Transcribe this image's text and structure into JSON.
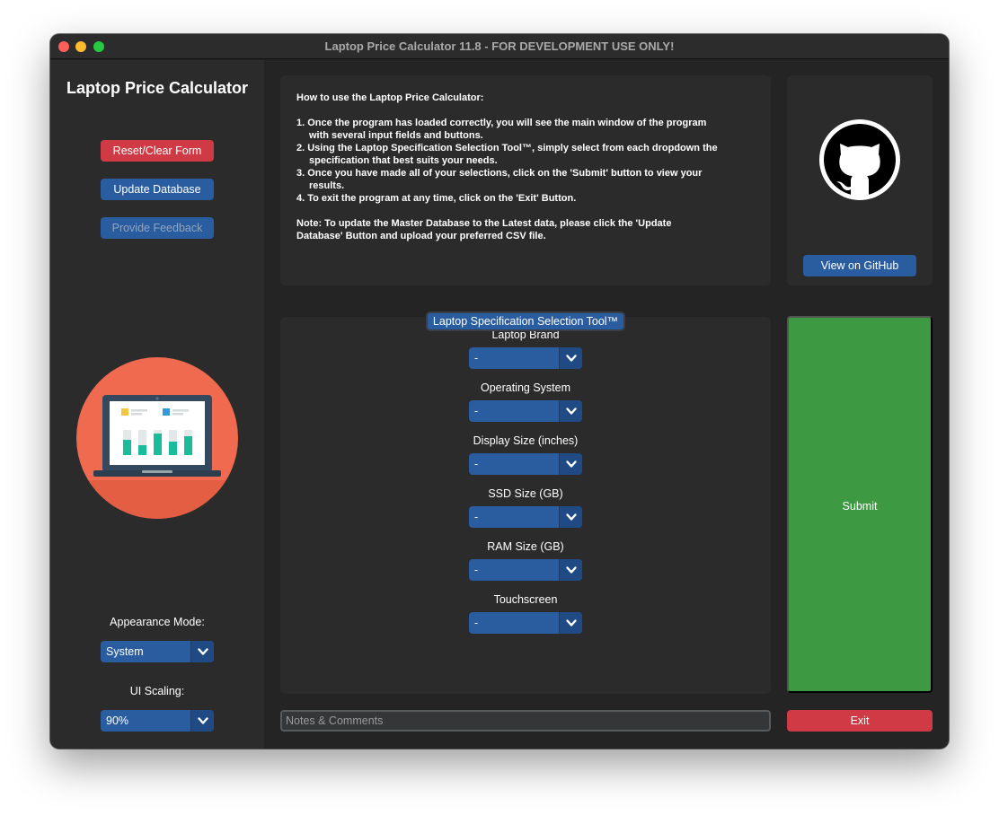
{
  "window": {
    "title": "Laptop Price Calculator 11.8 - FOR DEVELOPMENT USE ONLY!"
  },
  "sidebar": {
    "title": "Laptop Price Calculator",
    "reset_label": "Reset/Clear Form",
    "update_label": "Update Database",
    "feedback_label": "Provide Feedback",
    "appearance_label": "Appearance Mode:",
    "appearance_value": "System",
    "scaling_label": "UI Scaling:",
    "scaling_value": "90%"
  },
  "instructions": {
    "heading": "How to use the Laptop Price Calculator:",
    "steps": [
      "1. Once the program has loaded correctly, you will see the main window of the program with several input fields and buttons.",
      "2. Using the Laptop Specification Selection Tool™, simply select from each dropdown the specification that best suits your needs.",
      "3. Once you have made all of your selections, click on the 'Submit' button to view your results.",
      "4. To exit the program at any time, click on the 'Exit' Button."
    ],
    "note": "Note: To update the Master Database to the Latest data, please click the 'Update Database' Button and upload your preferred CSV file."
  },
  "github": {
    "button_label": "View on GitHub"
  },
  "spec_tool": {
    "title": "Laptop Specification Selection Tool™",
    "fields": [
      {
        "label": "Laptop Brand",
        "value": "-"
      },
      {
        "label": "Operating System",
        "value": "-"
      },
      {
        "label": "Display Size (inches)",
        "value": "-"
      },
      {
        "label": "SSD Size (GB)",
        "value": "-"
      },
      {
        "label": "RAM Size (GB)",
        "value": "-"
      },
      {
        "label": "Touchscreen",
        "value": "-"
      }
    ]
  },
  "actions": {
    "submit_label": "Submit",
    "exit_label": "Exit",
    "notes_placeholder": "Notes & Comments"
  },
  "colors": {
    "accent_blue": "#2a5d9f",
    "danger_red": "#cf3a45",
    "submit_green": "#3d9a42",
    "illustration_orange": "#ef6a4f"
  }
}
